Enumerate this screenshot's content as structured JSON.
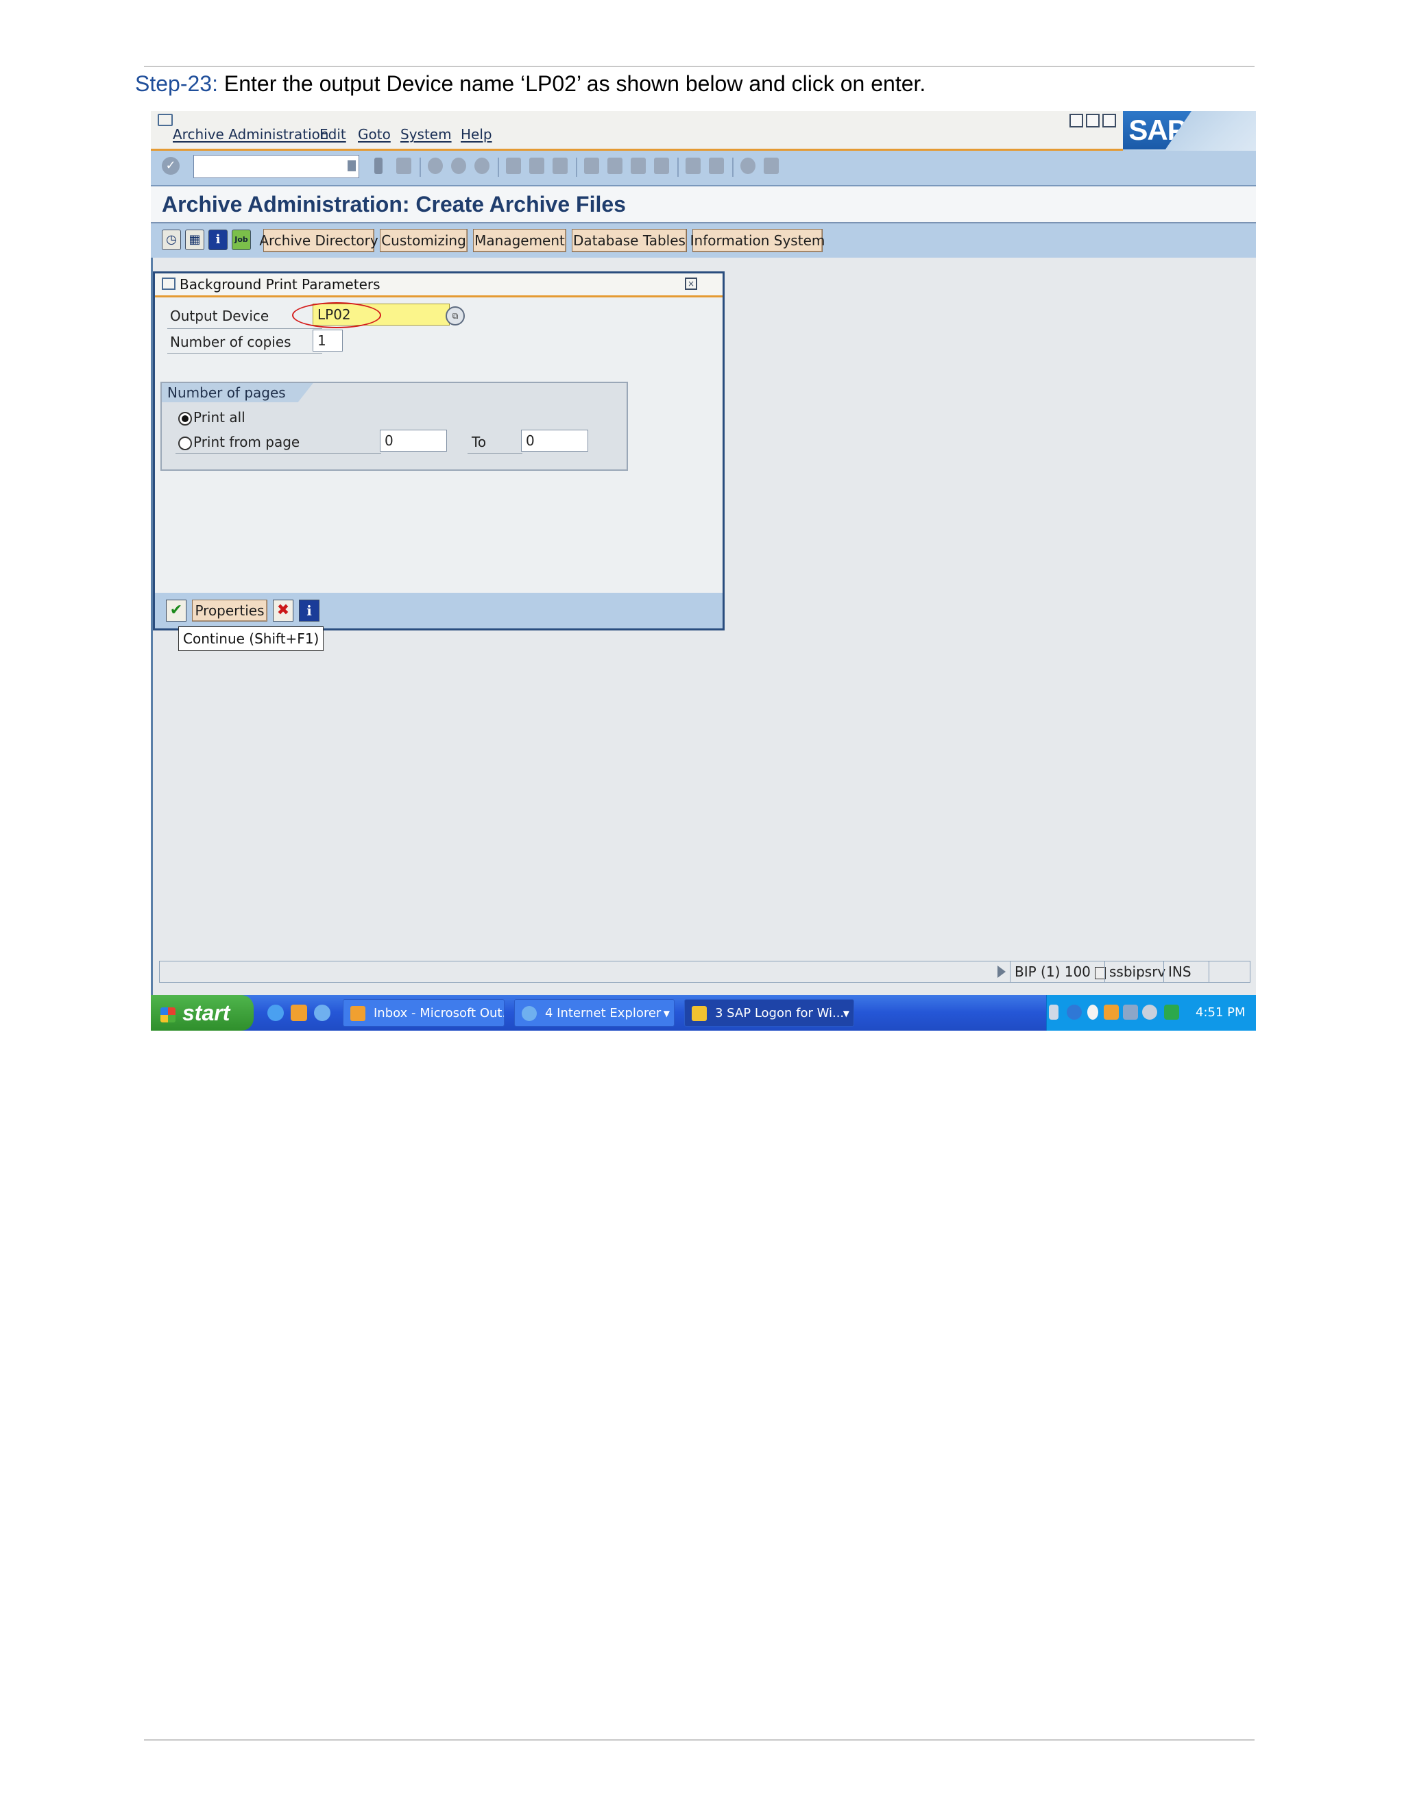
{
  "document": {
    "step_number": "Step-23:",
    "step_text": " Enter the output Device name ‘LP02’ as shown below and click on enter."
  },
  "sap": {
    "menu": [
      "Archive Administration",
      "Edit",
      "Goto",
      "System",
      "Help"
    ],
    "logo_text": "SAP",
    "title": "Archive Administration: Create Archive Files",
    "app_toolbar_buttons": [
      "Archive Directory",
      "Customizing",
      "Management",
      "Database Tables",
      "Information System"
    ],
    "dialog": {
      "title": "Background Print Parameters",
      "output_device_label": "Output Device",
      "output_device_value": "LP02",
      "copies_label": "Number of copies",
      "copies_value": "1",
      "pages_group_title": "Number of pages",
      "print_all_label": "Print all",
      "print_from_label": "Print from page",
      "from_value": "0",
      "to_label": "To",
      "to_value": "0",
      "properties_button": "Properties",
      "selected_option": "Print all"
    },
    "tooltip": "Continue   (Shift+F1)",
    "status_bar": {
      "system": "BIP (1) 100",
      "server": "ssbipsrv",
      "mode": "INS"
    }
  },
  "taskbar": {
    "start_label": "start",
    "tasks": [
      "Inbox - Microsoft Out...",
      "4 Internet Explorer",
      "3 SAP Logon for Wi..."
    ],
    "clock": "4:51 PM"
  },
  "colors": {
    "accent_orange": "#e59a32",
    "sap_blue": "#b5cde6",
    "highlight_red": "#d41c1c",
    "input_yellow": "#fbf58b"
  }
}
